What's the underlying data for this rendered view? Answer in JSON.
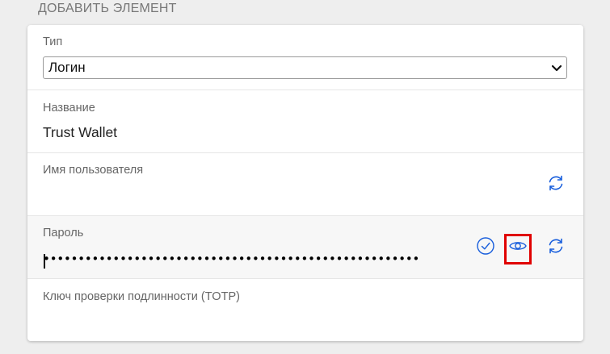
{
  "header": {
    "title": "ДОБАВИТЬ ЭЛЕМЕНТ"
  },
  "form": {
    "type": {
      "label": "Тип",
      "selected": "Логин"
    },
    "name": {
      "label": "Название",
      "value": "Trust Wallet"
    },
    "username": {
      "label": "Имя пользователя",
      "value": ""
    },
    "password": {
      "label": "Пароль",
      "masked_value": "••••••••••••••••••••••••••••••••••••••••••••••••••••••"
    },
    "totp": {
      "label": "Ключ проверки подлинности (TOTP)",
      "value": ""
    }
  },
  "colors": {
    "icon_blue": "#175ddc",
    "highlight_red": "#e00000"
  },
  "icons": {
    "regenerate": "refresh-icon",
    "check": "check-circle-icon",
    "toggle_visibility": "eye-icon",
    "dropdown": "chevron-down-icon"
  }
}
